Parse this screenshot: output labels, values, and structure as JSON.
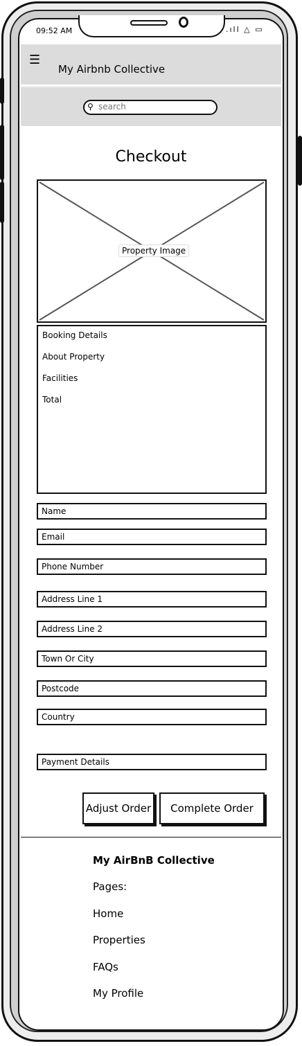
{
  "status_bar": {
    "time": "09:52 AM",
    "signal": ".ıll",
    "wifi": "△",
    "battery": "▭"
  },
  "header": {
    "menu_icon": "☰",
    "title": "My Airbnb Collective"
  },
  "search": {
    "icon": "⚲",
    "placeholder": "search"
  },
  "page": {
    "title": "Checkout"
  },
  "property": {
    "image_label": "Property Image"
  },
  "details": {
    "items": [
      "Booking Details",
      "About Property",
      "Facilities",
      "Total"
    ]
  },
  "form": {
    "fields": [
      "Name",
      "Email",
      "Phone Number",
      "Address Line 1",
      "Address Line 2",
      "Town Or City",
      "Postcode",
      "Country"
    ],
    "payment": "Payment Details"
  },
  "buttons": {
    "adjust": "Adjust Order",
    "complete": "Complete Order"
  },
  "footer": {
    "brand": "My AirBnB Collective",
    "pages_label": "Pages:",
    "links": [
      "Home",
      "Properties",
      "FAQs",
      "My Profile"
    ]
  }
}
